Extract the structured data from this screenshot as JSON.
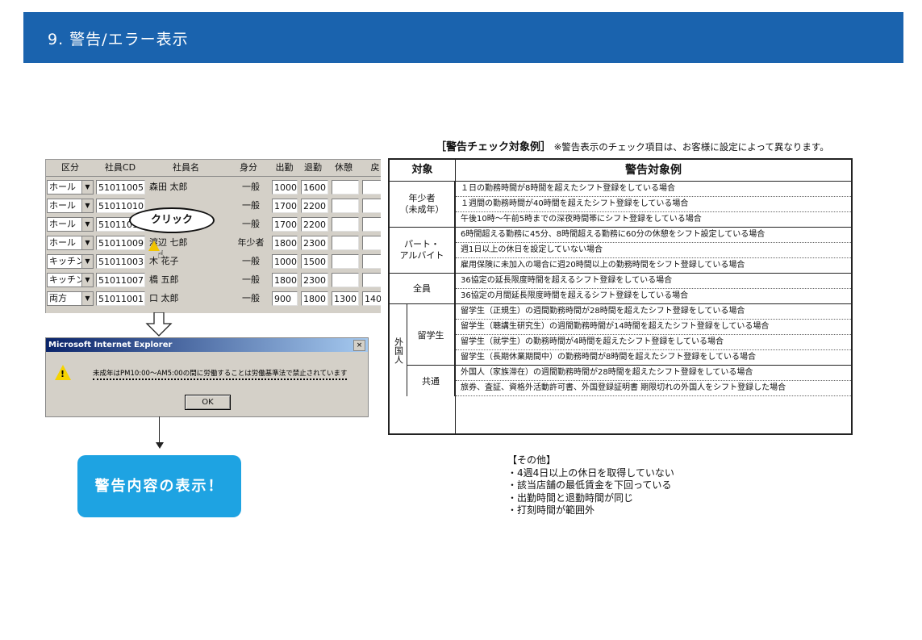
{
  "header": {
    "title": "9. 警告/エラー表示"
  },
  "sheet": {
    "columns": [
      "区分",
      "社員CD",
      "社員名",
      "身分",
      "出勤",
      "退勤",
      "休憩",
      "戻"
    ],
    "rows": [
      {
        "kubun": "ホール",
        "cd": "51011005",
        "name": "森田 太郎",
        "mibun": "一般",
        "in": "1000",
        "out": "1600",
        "brk": "",
        "ret": ""
      },
      {
        "kubun": "ホール",
        "cd": "51011010",
        "name": "",
        "mibun": "一般",
        "in": "1700",
        "out": "2200",
        "brk": "",
        "ret": ""
      },
      {
        "kubun": "ホール",
        "cd": "51011012",
        "name": "",
        "mibun": "一般",
        "in": "1700",
        "out": "2200",
        "brk": "",
        "ret": ""
      },
      {
        "kubun": "ホール",
        "cd": "51011009",
        "name": "渡辺 七郎",
        "mibun": "年少者",
        "in": "1800",
        "out": "2300",
        "brk": "",
        "ret": ""
      },
      {
        "kubun": "キッチン",
        "cd": "51011003",
        "name": "木 花子",
        "mibun": "一般",
        "in": "1000",
        "out": "1500",
        "brk": "",
        "ret": ""
      },
      {
        "kubun": "キッチン",
        "cd": "51011007",
        "name": "橋 五郎",
        "mibun": "一般",
        "in": "1800",
        "out": "2300",
        "brk": "",
        "ret": ""
      },
      {
        "kubun": "両方",
        "cd": "51011001",
        "name": "口 太郎",
        "mibun": "一般",
        "in": "900",
        "out": "1800",
        "brk": "1300",
        "ret": "140"
      }
    ],
    "callout": "クリック"
  },
  "dialog": {
    "title": "Microsoft Internet Explorer",
    "message": "未成年はPM10:00～AM5:00の間に労働することは労働基準法で禁止されています",
    "ok": "OK",
    "close": "×"
  },
  "badge": "警告内容の表示！",
  "caption": {
    "bold": "［警告チェック対象例］",
    "note": "※警告表示のチェック項目は、お客様に設定によって異なります。"
  },
  "table": {
    "head_left": "対象",
    "head_right": "警告対象例",
    "groups": [
      {
        "label": "年少者\n（未成年）",
        "items": [
          "１日の勤務時間が8時間を超えたシフト登録をしている場合",
          "１週間の勤務時間が40時間を超えたシフト登録をしている場合",
          "午後10時～午前5時までの深夜時間帯にシフト登録をしている場合"
        ]
      },
      {
        "label": "パート・\nアルバイト",
        "items": [
          "6時間超える勤務に45分、8時間超える勤務に60分の休憩をシフト設定している場合",
          "週1日以上の休日を設定していない場合",
          "雇用保険に未加入の場合に週20時間以上の勤務時間をシフト登録している場合"
        ]
      },
      {
        "label": "全員",
        "items": [
          "36協定の延長限度時間を超えるシフト登録をしている場合",
          "36協定の月間延長限度時間を超えるシフト登録をしている場合"
        ]
      }
    ],
    "foreign_label": "外国人",
    "foreign_sub": [
      {
        "label": "留学生",
        "items": [
          "留学生（正規生）の週間勤務時間が28時間を超えたシフト登録をしている場合",
          "留学生（聴講生研究生）の週間勤務時間が14時間を超えたシフト登録をしている場合",
          "留学生（就学生）の勤務時間が4時間を超えたシフト登録をしている場合",
          "留学生（長期休業期間中）の勤務時間が8時間を超えたシフト登録をしている場合"
        ]
      },
      {
        "label": "共通",
        "items": [
          "外国人（家族滞在）の週間勤務時間が28時間を超えたシフト登録をしている場合",
          "旅券、査証、資格外活動許可書、外国登録証明書 期限切れの外国人をシフト登録した場合"
        ]
      }
    ]
  },
  "other": {
    "title": "【その他】",
    "items": [
      "・4週4日以上の休日を取得していない",
      "・該当店舗の最低賃金を下回っている",
      "・出勤時間と退勤時間が同じ",
      "・打刻時間が範囲外"
    ]
  }
}
